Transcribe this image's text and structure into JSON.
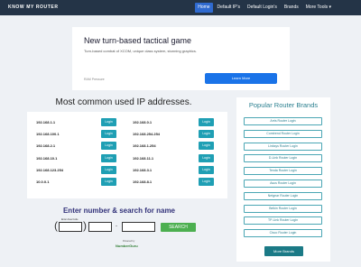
{
  "navbar": {
    "brand": "KNOW MY ROUTER",
    "items": [
      {
        "label": "Home",
        "active": true
      },
      {
        "label": "Default IP's",
        "active": false
      },
      {
        "label": "Default Login's",
        "active": false
      },
      {
        "label": "Brands",
        "active": false
      },
      {
        "label": "More Tools ▾",
        "active": false
      }
    ]
  },
  "ad": {
    "title": "New turn-based tactical game",
    "description": "Turn-based combat of XCOM, unique class system, stunning graphics.",
    "source": "RAM Pressure",
    "cta": "Learn More"
  },
  "ip_section": {
    "title": "Most common used IP addresses.",
    "login_label": "Login",
    "left": [
      "192.168.1.1",
      "192.168.100.1",
      "192.168.2.1",
      "192.168.10.1",
      "192.168.123.254",
      "10.0.0.1"
    ],
    "right": [
      "192.168.0.1",
      "192.168.254.254",
      "192.168.1.254",
      "192.168.11.1",
      "192.168.3.1",
      "192.168.8.1"
    ]
  },
  "search": {
    "title": "Enter number & search for name",
    "hint": "Enter Area Code",
    "button": "SEARCH",
    "powered_by": "Powered by",
    "logo": "NumberGuru"
  },
  "brands": {
    "title": "Popular Router Brands",
    "items": [
      "Arris Router Login",
      "Comtrend Router Login",
      "Linksys Router Login",
      "D-Link Router Login",
      "Tenda Router Login",
      "Asus Router Login",
      "Netgear Router Login",
      "Belkin Router Login",
      "TP-Link Router Login",
      "Cisco Router Login"
    ],
    "more": "More Brands"
  },
  "colors": {
    "navbar": "#243447",
    "nav_active": "#2f6ad0",
    "login_button": "#1f9fb4",
    "search_button": "#4caf50",
    "brand_accent": "#2a7f8f"
  }
}
